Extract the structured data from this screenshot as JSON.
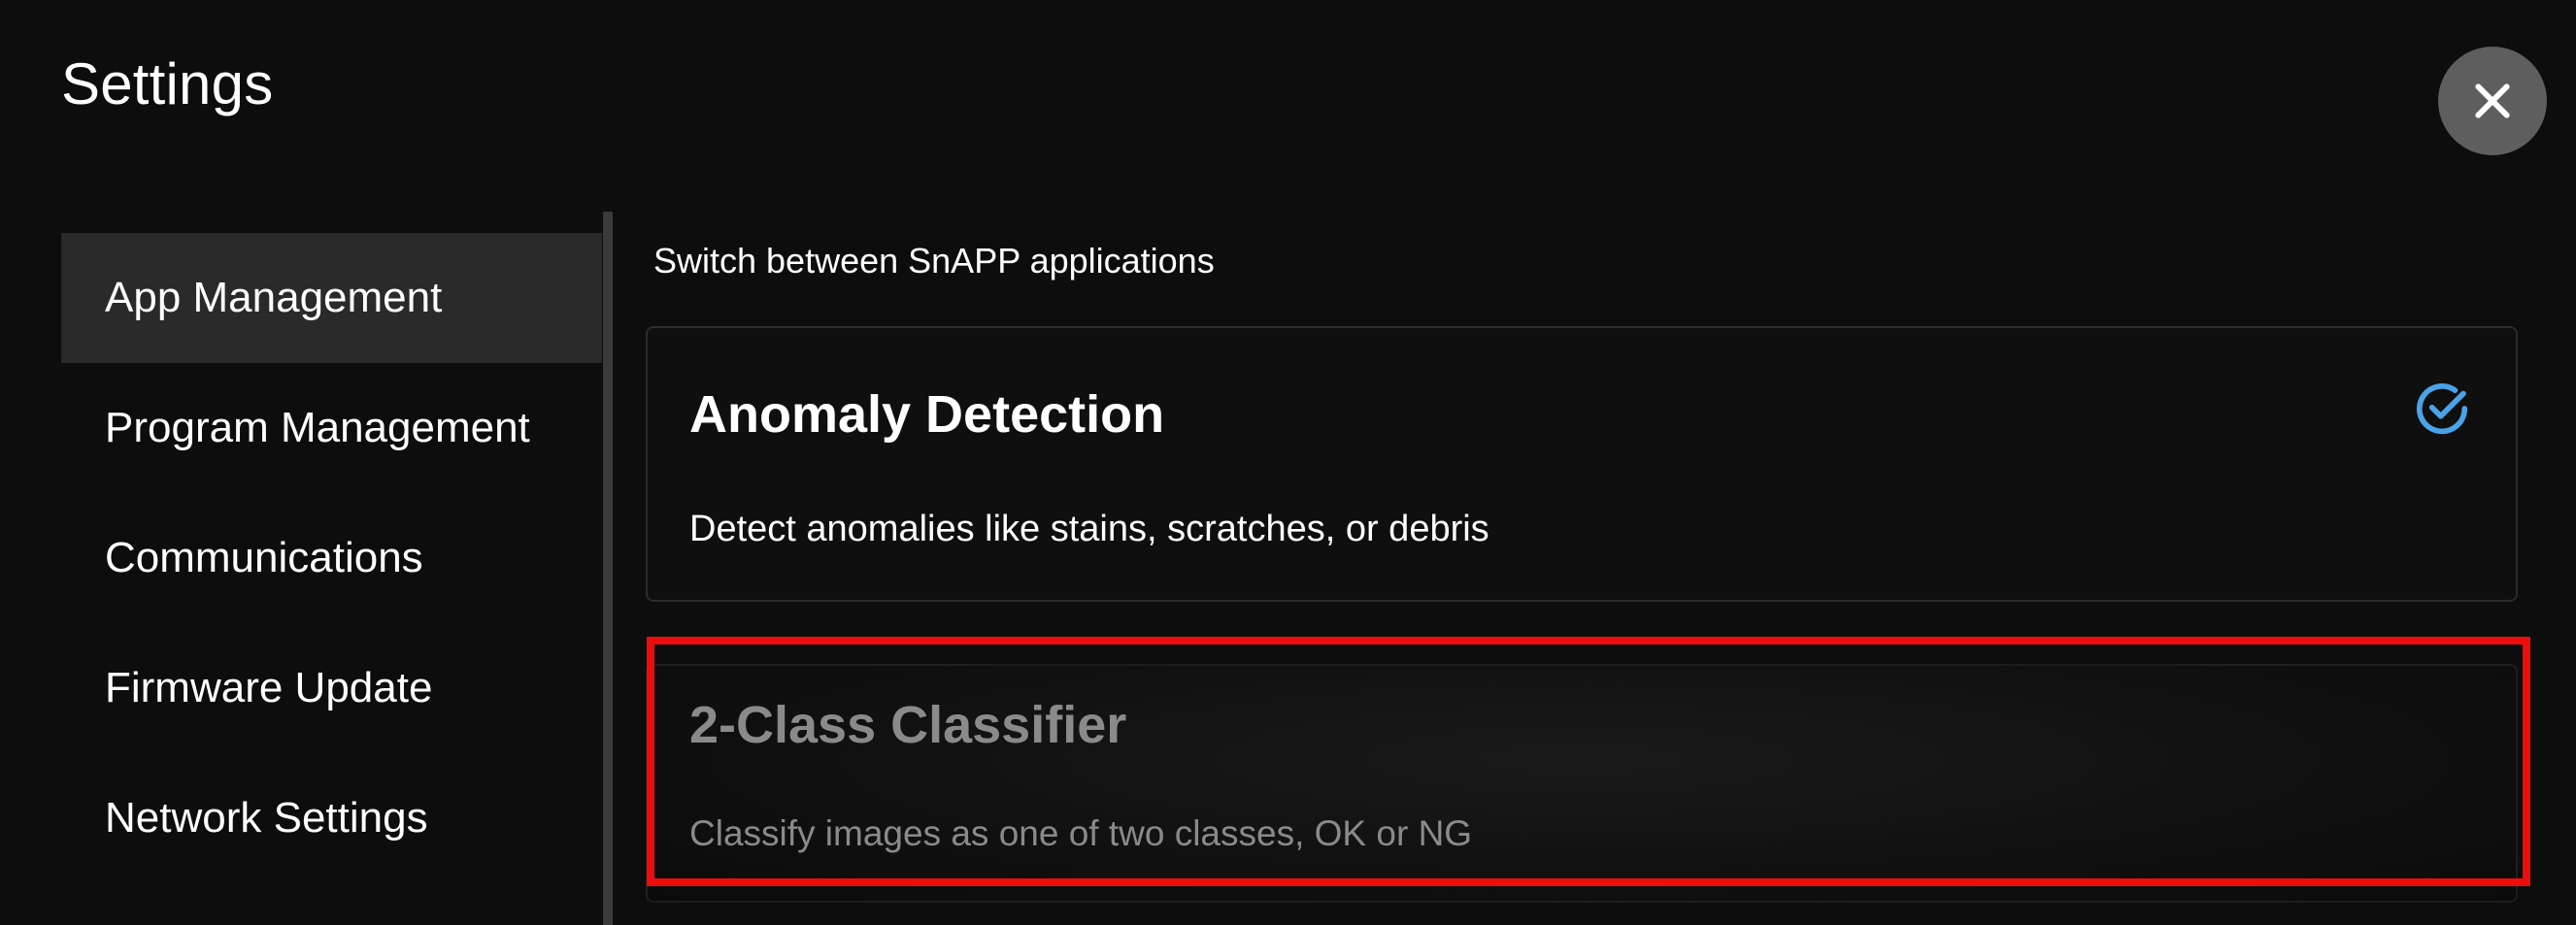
{
  "dialog": {
    "title": "Settings"
  },
  "sidebar": {
    "items": [
      {
        "label": "App Management",
        "active": true
      },
      {
        "label": "Program Management",
        "active": false
      },
      {
        "label": "Communications",
        "active": false
      },
      {
        "label": "Firmware Update",
        "active": false
      },
      {
        "label": "Network Settings",
        "active": false
      }
    ]
  },
  "main": {
    "section_label": "Switch between SnAPP applications",
    "apps": [
      {
        "title": "Anomaly Detection",
        "description": "Detect anomalies like stains, scratches, or debris",
        "selected": true,
        "icon": "check-circle-icon"
      },
      {
        "title": "2-Class Classifier",
        "description": "Classify images as one of two classes, OK or NG",
        "selected": false
      }
    ]
  },
  "colors": {
    "background": "#0d0d0d",
    "active_item": "#2a2a2a",
    "accent_check": "#4aa3e8",
    "highlight_border": "#ee0d0d",
    "disabled_text": "#8a8a8a"
  }
}
